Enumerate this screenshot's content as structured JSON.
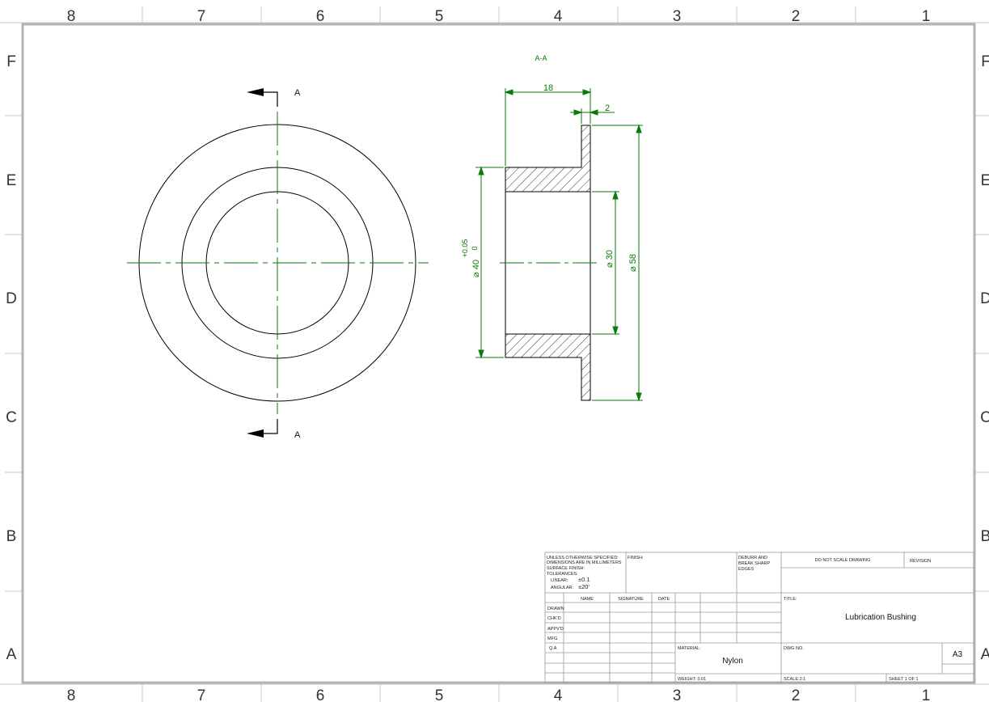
{
  "border": {
    "columns": [
      "8",
      "7",
      "6",
      "5",
      "4",
      "3",
      "2",
      "1"
    ],
    "rows": [
      "F",
      "E",
      "D",
      "C",
      "B",
      "A"
    ]
  },
  "section": {
    "view_label": "A-A",
    "cut_label_top": "A",
    "cut_label_bottom": "A"
  },
  "dimensions": {
    "flange_to_face": "18",
    "flange_thickness": "2",
    "outer_diameter": "⌀ 58",
    "bore_diameter": "⌀ 30",
    "body_diameter": "⌀ 40",
    "body_tol_upper": "+0.05",
    "body_tol_lower": "0"
  },
  "title_block": {
    "notes_line1": "UNLESS OTHERWISE SPECIFIED:",
    "notes_line2": "DIMENSIONS ARE IN MILLIMETERS",
    "notes_line3": "SURFACE FINISH:",
    "notes_line4": "TOLERANCES:",
    "linear_label": "LINEAR:",
    "linear_value": "±0.1",
    "angular_label": "ANGULAR:",
    "angular_value": "±20'",
    "finish_label": "FINISH:",
    "deburr_line1": "DEBURR AND",
    "deburr_line2": "BREAK SHARP",
    "deburr_line3": "EDGES",
    "do_not_scale": "DO NOT SCALE DRAWING",
    "revision_label": "REVISION",
    "col_name": "NAME",
    "col_signature": "SIGNATURE",
    "col_date": "DATE",
    "row_drawn": "DRAWN",
    "row_chkd": "CHK'D",
    "row_appvd": "APPV'D",
    "row_mfg": "MFG",
    "row_qa": "Q.A",
    "title_label": "TITLE:",
    "title_value": "Lubrication Bushing",
    "material_label": "MATERIAL:",
    "material_value": "Nylon",
    "dwg_no_label": "DWG NO.",
    "sheet_size": "A3",
    "weight": "WEIGHT: 0.01",
    "scale": "SCALE:2:1",
    "sheet": "SHEET 1 OF 1"
  },
  "colors": {
    "line": "#000000",
    "dimension": "#0a7a0a",
    "border": "#b4b4b4"
  }
}
